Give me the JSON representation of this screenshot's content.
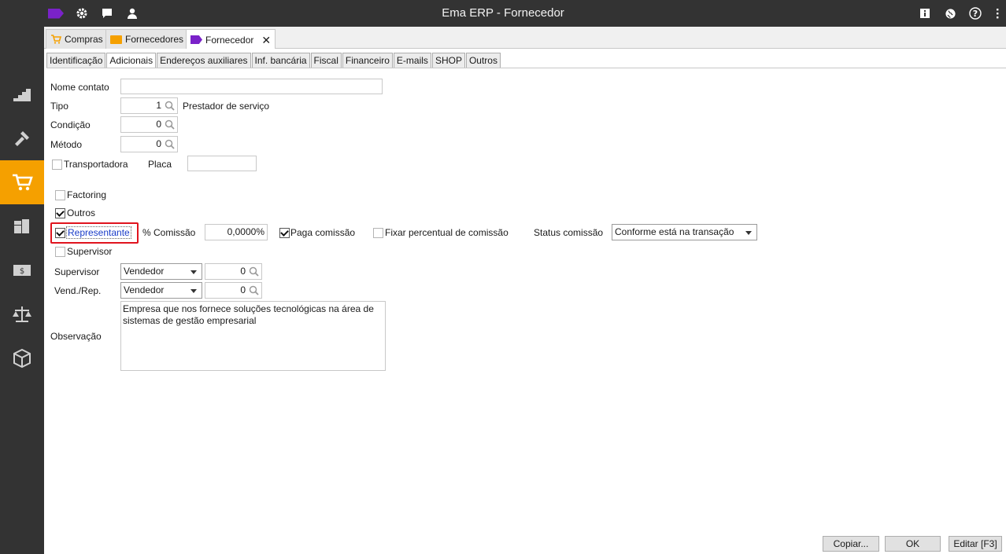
{
  "app": {
    "title": "Ema ERP - Fornecedor"
  },
  "titlebar_icons": [
    "logo-icon",
    "gear-icon",
    "chat-icon",
    "user-icon",
    "info-icon",
    "globe-icon",
    "help-icon",
    "menu-icon"
  ],
  "doc_tabs": [
    {
      "label": "Compras",
      "icon": "cart-icon"
    },
    {
      "label": "Fornecedores",
      "icon": "folder-icon"
    },
    {
      "label": "Fornecedor",
      "icon": "tag-icon",
      "active": true
    }
  ],
  "sub_tabs": [
    "Identificação",
    "Adicionais",
    "Endereços auxiliares",
    "Inf. bancária",
    "Fiscal",
    "Financeiro",
    "E-mails",
    "SHOP",
    "Outros"
  ],
  "active_sub_tab": "Adicionais",
  "form": {
    "nome_contato_label": "Nome contato",
    "nome_contato_value": "",
    "tipo_label": "Tipo",
    "tipo_value": "1",
    "tipo_desc": "Prestador de serviço",
    "condicao_label": "Condição",
    "condicao_value": "0",
    "metodo_label": "Método",
    "metodo_value": "0",
    "transportadora_label": "Transportadora",
    "placa_label": "Placa",
    "placa_value": "",
    "factoring_label": "Factoring",
    "outros_label": "Outros",
    "representante_label": "Representante",
    "comissao_label": "% Comissão",
    "comissao_value": "0,0000%",
    "paga_comissao_label": "Paga comissão",
    "fixar_label": "Fixar percentual de comissão",
    "status_comissao_label": "Status comissão",
    "status_comissao_value": "Conforme está na transação",
    "supervisor_check_label": "Supervisor",
    "supervisor_label": "Supervisor",
    "supervisor_select": "Vendedor",
    "supervisor_value": "0",
    "vendrep_label": "Vend./Rep.",
    "vendrep_select": "Vendedor",
    "vendrep_value": "0",
    "observacao_label": "Observação",
    "observacao_value": "Empresa que nos fornece soluções tecnológicas na área de sistemas de gestão empresarial"
  },
  "checks": {
    "transportadora": false,
    "factoring": false,
    "outros": true,
    "representante": true,
    "paga_comissao": true,
    "fixar": false,
    "supervisor": false
  },
  "buttons": {
    "copiar": "Copiar...",
    "ok": "OK",
    "editar": "Editar [F3]"
  },
  "colors": {
    "accent": "#f5a000",
    "brand": "#7a22c9",
    "dark": "#333333",
    "highlight": "#e0141e"
  }
}
